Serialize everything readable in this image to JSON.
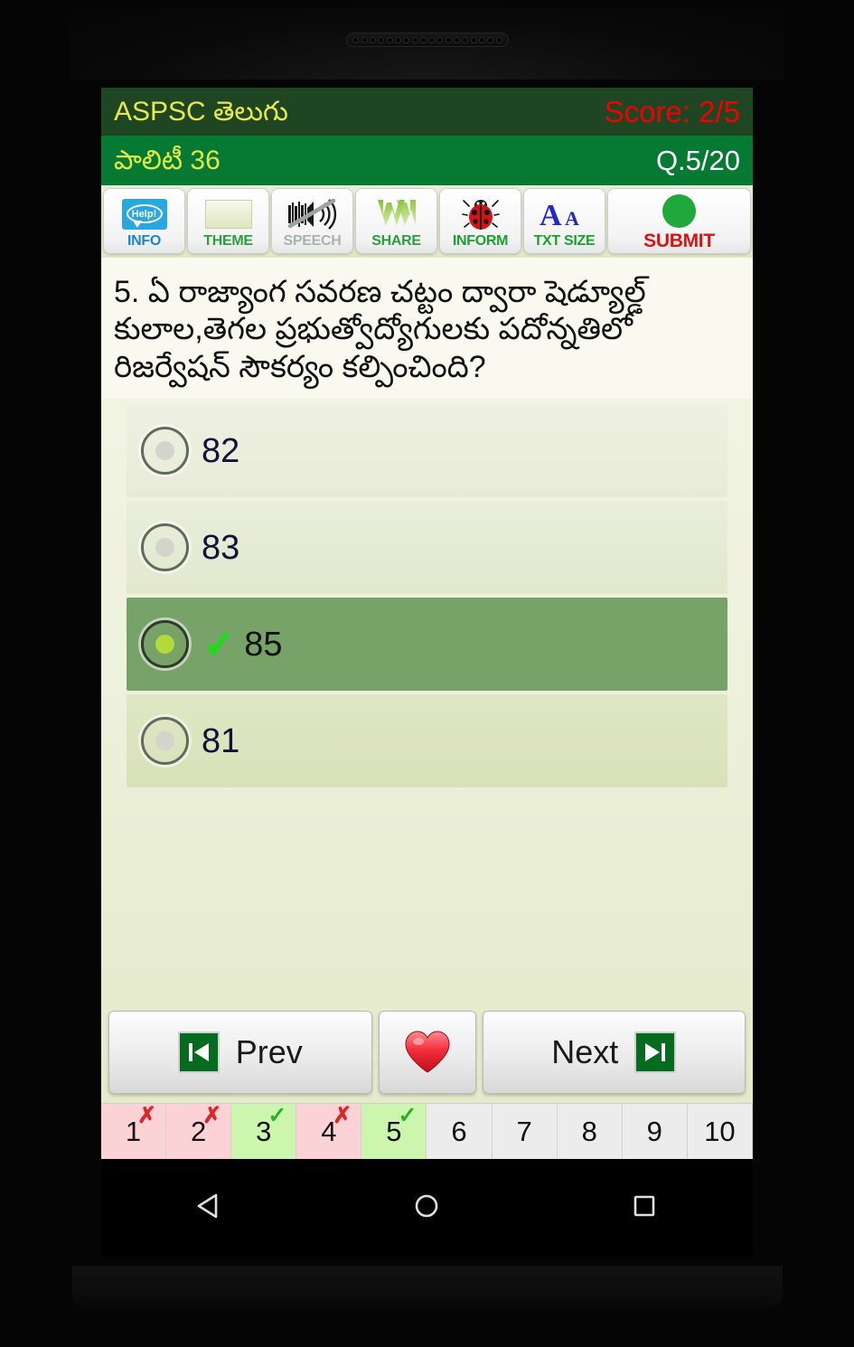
{
  "app": {
    "title": "ASPSC తెలుగు",
    "score_label": "Score: 2/5",
    "subject": "పాలిటీ 36",
    "question_counter": "Q.5/20"
  },
  "colors": {
    "title_bar": "#1f4622",
    "subject_bar": "#067a33",
    "title_text": "#e8e84a",
    "score_text": "#f40000",
    "selected_option": "#78a368",
    "correct_cell": "#ccf6ae",
    "wrong_cell": "#fbd3d6",
    "submit_dot": "#1fa83c"
  },
  "toolbar": [
    {
      "name": "info",
      "label": "INFO",
      "icon": "help-bubble-icon",
      "icon_text": "Help!",
      "enabled": true
    },
    {
      "name": "theme",
      "label": "THEME",
      "icon": "color-swatch-icon",
      "enabled": true
    },
    {
      "name": "speech",
      "label": "SPEECH",
      "icon": "speaker-muted-icon",
      "enabled": false
    },
    {
      "name": "share",
      "label": "SHARE",
      "icon": "whatsapp-w-icon",
      "enabled": true
    },
    {
      "name": "inform",
      "label": "INFORM",
      "icon": "ladybug-icon",
      "enabled": true
    },
    {
      "name": "txtsize",
      "label": "TXT SIZE",
      "icon": "font-size-aa-icon",
      "enabled": true
    },
    {
      "name": "submit",
      "label": "SUBMIT",
      "icon": "green-circle-icon",
      "enabled": true
    }
  ],
  "question": {
    "number": "5.",
    "text": "5. ఏ రాజ్యాంగ సవరణ చట్టం ద్వారా షెడ్యూల్డ్ కులాల,తెగల ప్రభుత్వోద్యోగులకు పదోన్నతిలో రిజర్వేషన్ సౌకర్యం కల్పించింది?"
  },
  "options": [
    {
      "label": "82",
      "selected": false,
      "correct_mark": false
    },
    {
      "label": "83",
      "selected": false,
      "correct_mark": false
    },
    {
      "label": "85",
      "selected": true,
      "correct_mark": true
    },
    {
      "label": "81",
      "selected": false,
      "correct_mark": false
    }
  ],
  "nav": {
    "prev_label": "Prev",
    "next_label": "Next",
    "favorite_icon": "heart-icon",
    "prev_icon": "skip-previous-icon",
    "next_icon": "skip-next-icon"
  },
  "question_strip": [
    {
      "number": "1",
      "state": "wrong",
      "mark": "✗"
    },
    {
      "number": "2",
      "state": "wrong",
      "mark": "✗"
    },
    {
      "number": "3",
      "state": "right",
      "mark": "✓"
    },
    {
      "number": "4",
      "state": "wrong",
      "mark": "✗"
    },
    {
      "number": "5",
      "state": "right",
      "mark": "✓"
    },
    {
      "number": "6",
      "state": "blank",
      "mark": ""
    },
    {
      "number": "7",
      "state": "blank",
      "mark": ""
    },
    {
      "number": "8",
      "state": "blank",
      "mark": ""
    },
    {
      "number": "9",
      "state": "blank",
      "mark": ""
    },
    {
      "number": "10",
      "state": "blank",
      "mark": ""
    }
  ],
  "android_nav": [
    {
      "name": "back-button",
      "icon": "triangle-left-icon"
    },
    {
      "name": "home-button",
      "icon": "circle-icon"
    },
    {
      "name": "recents-button",
      "icon": "square-icon"
    }
  ]
}
